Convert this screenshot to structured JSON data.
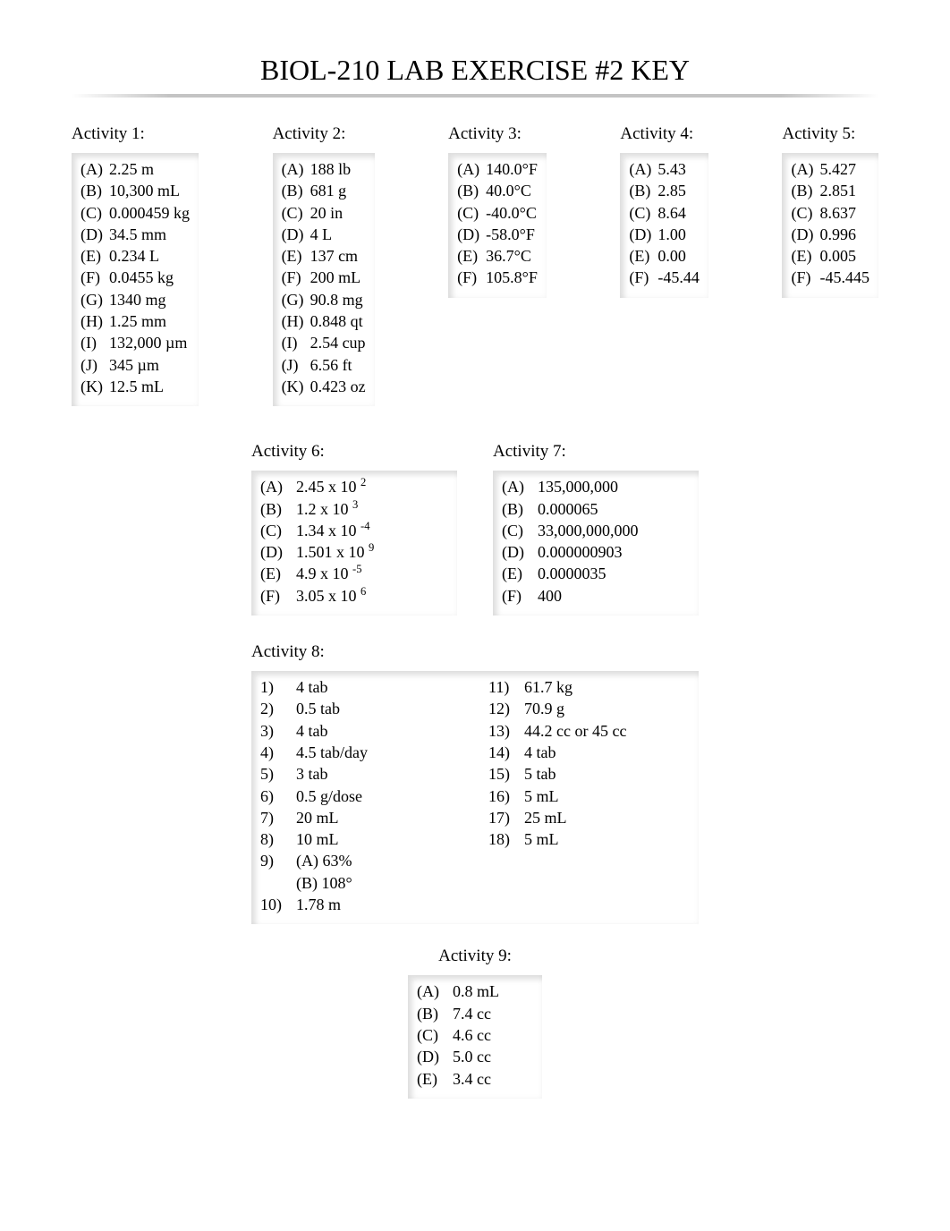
{
  "title": "BIOL-210 LAB EXERCISE #2 KEY",
  "row1": [
    {
      "label": "Activity 1:",
      "items": [
        {
          "m": "(A)",
          "v": "2.25 m"
        },
        {
          "m": "(B)",
          "v": "10,300 mL"
        },
        {
          "m": "(C)",
          "v": "0.000459 kg"
        },
        {
          "m": "(D)",
          "v": "34.5 mm"
        },
        {
          "m": "(E)",
          "v": "0.234 L"
        },
        {
          "m": "(F)",
          "v": "0.0455 kg"
        },
        {
          "m": "(G)",
          "v": "1340 mg"
        },
        {
          "m": "(H)",
          "v": "1.25 mm"
        },
        {
          "m": "(I)",
          "v": "132,000  µm"
        },
        {
          "m": "(J)",
          "v": "345 µm"
        },
        {
          "m": "(K)",
          "v": "12.5 mL"
        }
      ]
    },
    {
      "label": "Activity 2:",
      "items": [
        {
          "m": "(A)",
          "v": "188 lb"
        },
        {
          "m": "(B)",
          "v": "681 g"
        },
        {
          "m": "(C)",
          "v": "20 in"
        },
        {
          "m": "(D)",
          "v": "4 L"
        },
        {
          "m": "(E)",
          "v": "137 cm"
        },
        {
          "m": "(F)",
          "v": "200 mL"
        },
        {
          "m": "(G)",
          "v": "90.8 mg"
        },
        {
          "m": "(H)",
          "v": "0.848 qt"
        },
        {
          "m": "(I)",
          "v": "2.54 cup"
        },
        {
          "m": "(J)",
          "v": "6.56 ft"
        },
        {
          "m": "(K)",
          "v": "0.423 oz"
        }
      ]
    },
    {
      "label": "Activity 3:",
      "items": [
        {
          "m": "(A)",
          "v": "140.0°F"
        },
        {
          "m": "(B)",
          "v": "40.0°C"
        },
        {
          "m": "(C)",
          "v": "-40.0°C"
        },
        {
          "m": "(D)",
          "v": "-58.0°F"
        },
        {
          "m": "(E)",
          "v": "36.7°C"
        },
        {
          "m": "(F)",
          "v": "105.8°F"
        }
      ]
    },
    {
      "label": "Activity 4:",
      "items": [
        {
          "m": "(A)",
          "v": "5.43"
        },
        {
          "m": "(B)",
          "v": "2.85"
        },
        {
          "m": "(C)",
          "v": "8.64"
        },
        {
          "m": "(D)",
          "v": "1.00"
        },
        {
          "m": "(E)",
          "v": "0.00"
        },
        {
          "m": "(F)",
          "v": "-45.44"
        }
      ]
    },
    {
      "label": "Activity 5:",
      "items": [
        {
          "m": "(A)",
          "v": "5.427"
        },
        {
          "m": "(B)",
          "v": "2.851"
        },
        {
          "m": "(C)",
          "v": "8.637"
        },
        {
          "m": "(D)",
          "v": "0.996"
        },
        {
          "m": "(E)",
          "v": "0.005"
        },
        {
          "m": "(F)",
          "v": "-45.445"
        }
      ]
    }
  ],
  "activity6": {
    "label": "Activity 6:",
    "items": [
      {
        "m": "(A)",
        "base": "2.45 x 10",
        "exp": "2"
      },
      {
        "m": "(B)",
        "base": "1.2 x 10",
        "exp": "3"
      },
      {
        "m": "(C)",
        "base": "1.34 x 10",
        "exp": "-4"
      },
      {
        "m": "(D)",
        "base": "1.501 x 10",
        "exp": "9"
      },
      {
        "m": "(E)",
        "base": "4.9 x 10",
        "exp": "-5"
      },
      {
        "m": "(F)",
        "base": "3.05 x 10",
        "exp": "6"
      }
    ]
  },
  "activity7": {
    "label": "Activity 7:",
    "items": [
      {
        "m": "(A)",
        "v": "135,000,000"
      },
      {
        "m": "(B)",
        "v": "0.000065"
      },
      {
        "m": "(C)",
        "v": "33,000,000,000"
      },
      {
        "m": "(D)",
        "v": "0.000000903"
      },
      {
        "m": "(E)",
        "v": "0.0000035"
      },
      {
        "m": "(F)",
        "v": "400"
      }
    ]
  },
  "activity8": {
    "label": "Activity 8:",
    "left": [
      {
        "m": "1)",
        "v": "4 tab"
      },
      {
        "m": "2)",
        "v": "0.5 tab"
      },
      {
        "m": "3)",
        "v": "4 tab"
      },
      {
        "m": "4)",
        "v": "4.5 tab/day"
      },
      {
        "m": "5)",
        "v": "3 tab"
      },
      {
        "m": "6)",
        "v": "0.5 g/dose"
      },
      {
        "m": "7)",
        "v": "20 mL"
      },
      {
        "m": "8)",
        "v": "10 mL"
      },
      {
        "m": "9)",
        "v": "(A) 63%"
      },
      {
        "m": "",
        "v": "(B) 108°"
      },
      {
        "m": "10)",
        "v": "  1.78 m"
      }
    ],
    "right": [
      {
        "m": "11)",
        "v": "  61.7 kg"
      },
      {
        "m": "12)",
        "v": "  70.9 g"
      },
      {
        "m": "13)",
        "v": "  44.2 cc or 45 cc"
      },
      {
        "m": "14)",
        "v": "  4 tab"
      },
      {
        "m": "15)",
        "v": "  5 tab"
      },
      {
        "m": "16)",
        "v": "  5 mL"
      },
      {
        "m": "17)",
        "v": "  25 mL"
      },
      {
        "m": "18)",
        "v": "  5 mL"
      }
    ]
  },
  "activity9": {
    "label": "Activity 9:",
    "items": [
      {
        "m": "(A)",
        "v": "0.8 mL"
      },
      {
        "m": "(B)",
        "v": "7.4 cc"
      },
      {
        "m": "(C)",
        "v": "4.6 cc"
      },
      {
        "m": "(D)",
        "v": "5.0 cc"
      },
      {
        "m": "(E)",
        "v": "3.4 cc"
      }
    ]
  }
}
